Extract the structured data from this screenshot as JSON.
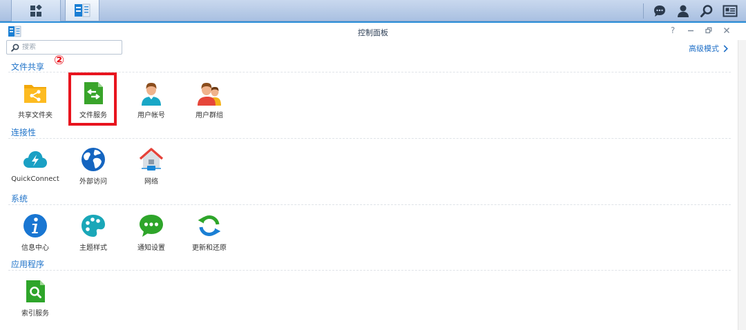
{
  "window": {
    "title": "控制面板"
  },
  "search": {
    "placeholder": "搜索"
  },
  "advanced_mode": {
    "label": "高级模式"
  },
  "annotation": {
    "number": "②"
  },
  "sections": [
    {
      "title": "文件共享",
      "items": [
        {
          "label": "共享文件夹",
          "icon": "shared-folder-icon"
        },
        {
          "label": "文件服务",
          "icon": "file-services-icon"
        },
        {
          "label": "用户帐号",
          "icon": "user-icon"
        },
        {
          "label": "用户群组",
          "icon": "group-icon"
        }
      ]
    },
    {
      "title": "连接性",
      "items": [
        {
          "label": "QuickConnect",
          "icon": "quickconnect-cloud-icon"
        },
        {
          "label": "外部访问",
          "icon": "globe-icon"
        },
        {
          "label": "网络",
          "icon": "network-house-icon"
        }
      ]
    },
    {
      "title": "系统",
      "items": [
        {
          "label": "信息中心",
          "icon": "info-icon"
        },
        {
          "label": "主题样式",
          "icon": "palette-icon"
        },
        {
          "label": "通知设置",
          "icon": "notification-bubble-icon"
        },
        {
          "label": "更新和还原",
          "icon": "update-restore-icon"
        }
      ]
    },
    {
      "title": "应用程序",
      "items": [
        {
          "label": "索引服务",
          "icon": "indexing-service-icon"
        }
      ]
    }
  ],
  "colors": {
    "accent": "#1f73c9",
    "annotation": "#e8141e",
    "taskbar": "#b4c8e6"
  }
}
